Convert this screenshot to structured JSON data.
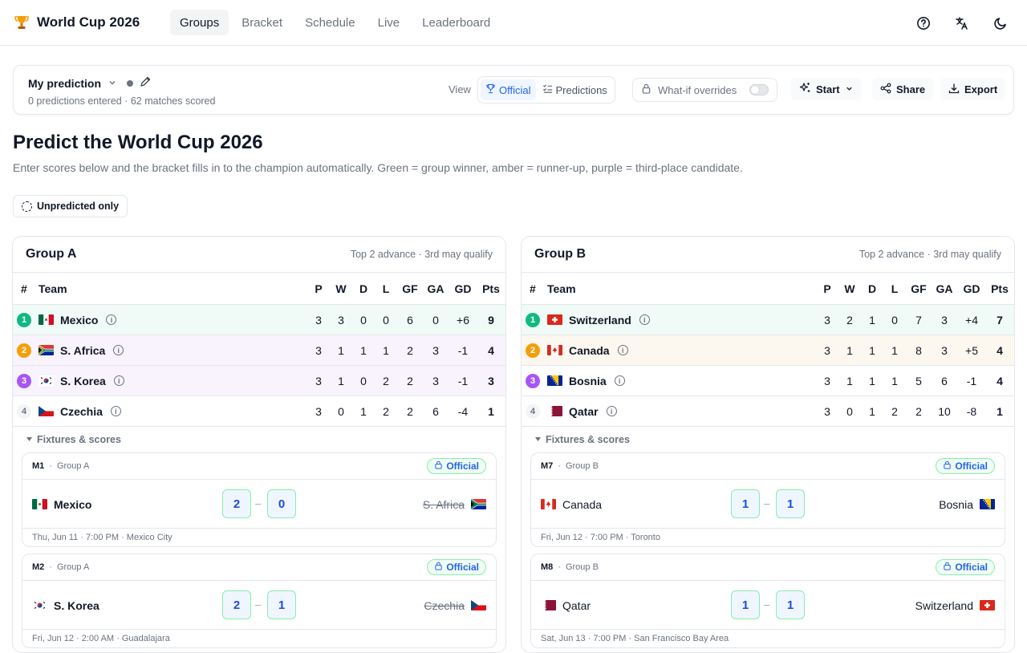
{
  "app": {
    "title": "World Cup 2026"
  },
  "nav": {
    "tabs": [
      {
        "label": "Groups"
      },
      {
        "label": "Bracket"
      },
      {
        "label": "Schedule"
      },
      {
        "label": "Live"
      },
      {
        "label": "Leaderboard"
      }
    ],
    "active": "Groups"
  },
  "prediction": {
    "name": "My prediction",
    "subtitle": "0 predictions entered · 62 matches scored",
    "view_label": "View",
    "view_official": "Official",
    "view_predictions": "Predictions",
    "whatif_label": "What-if overrides",
    "whatif_enabled": false,
    "start_label": "Start",
    "share_label": "Share",
    "export_label": "Export"
  },
  "page": {
    "title": "Predict the World Cup 2026",
    "subtitle": "Enter scores below and the bracket fills in to the champion automatically. Green = group winner, amber = runner-up, purple = third-place candidate.",
    "filter_label": "Unpredicted only"
  },
  "table_headers": {
    "num": "#",
    "team": "Team",
    "p": "P",
    "w": "W",
    "d": "D",
    "l": "L",
    "gf": "GF",
    "ga": "GA",
    "gd": "GD",
    "pts": "Pts"
  },
  "colors": {
    "winner": "#10b981",
    "runner_up": "#f59e0b",
    "third": "#a855f7",
    "accent": "#2563eb"
  },
  "groups": [
    {
      "name": "Group A",
      "note": "Top 2 advance · 3rd may qualify",
      "fixtures_label": "Fixtures & scores",
      "rows": [
        {
          "rank": "1",
          "team": "Mexico",
          "flag": "mexico",
          "p": "3",
          "w": "3",
          "d": "0",
          "l": "0",
          "gf": "6",
          "ga": "0",
          "gd": "+6",
          "pts": "9"
        },
        {
          "rank": "2",
          "team": "S. Africa",
          "flag": "south-africa",
          "p": "3",
          "w": "1",
          "d": "1",
          "l": "1",
          "gf": "2",
          "ga": "3",
          "gd": "-1",
          "pts": "4"
        },
        {
          "rank": "3",
          "team": "S. Korea",
          "flag": "south-korea",
          "p": "3",
          "w": "1",
          "d": "0",
          "l": "2",
          "gf": "2",
          "ga": "3",
          "gd": "-1",
          "pts": "3"
        },
        {
          "rank": "4",
          "team": "Czechia",
          "flag": "czechia",
          "p": "3",
          "w": "0",
          "d": "1",
          "l": "2",
          "gf": "2",
          "ga": "6",
          "gd": "-4",
          "pts": "1"
        }
      ],
      "matches": [
        {
          "id": "M1",
          "group": "Group A",
          "badge": "Official",
          "home": "Mexico",
          "away": "S. Africa",
          "home_score": "2",
          "away_score": "0",
          "info": "Thu, Jun 11 · 7:00 PM · Mexico City"
        },
        {
          "id": "M2",
          "group": "Group A",
          "badge": "Official",
          "home": "S. Korea",
          "away": "Czechia",
          "home_score": "2",
          "away_score": "1",
          "info": "Fri, Jun 12 · 2:00 AM · Guadalajara"
        }
      ]
    },
    {
      "name": "Group B",
      "note": "Top 2 advance · 3rd may qualify",
      "fixtures_label": "Fixtures & scores",
      "rows": [
        {
          "rank": "1",
          "team": "Switzerland",
          "flag": "switzerland",
          "p": "3",
          "w": "2",
          "d": "1",
          "l": "0",
          "gf": "7",
          "ga": "3",
          "gd": "+4",
          "pts": "7"
        },
        {
          "rank": "2",
          "team": "Canada",
          "flag": "canada",
          "p": "3",
          "w": "1",
          "d": "1",
          "l": "1",
          "gf": "8",
          "ga": "3",
          "gd": "+5",
          "pts": "4"
        },
        {
          "rank": "3",
          "team": "Bosnia",
          "flag": "bosnia",
          "p": "3",
          "w": "1",
          "d": "1",
          "l": "1",
          "gf": "5",
          "ga": "6",
          "gd": "-1",
          "pts": "4"
        },
        {
          "rank": "4",
          "team": "Qatar",
          "flag": "qatar",
          "p": "3",
          "w": "0",
          "d": "1",
          "l": "2",
          "gf": "2",
          "ga": "10",
          "gd": "-8",
          "pts": "1"
        }
      ],
      "matches": [
        {
          "id": "M7",
          "group": "Group B",
          "badge": "Official",
          "home": "Canada",
          "away": "Bosnia",
          "home_score": "1",
          "away_score": "1",
          "info": "Fri, Jun 12 · 7:00 PM · Toronto"
        },
        {
          "id": "M8",
          "group": "Group B",
          "badge": "Official",
          "home": "Qatar",
          "away": "Switzerland",
          "home_score": "1",
          "away_score": "1",
          "info": "Sat, Jun 13 · 7:00 PM · San Francisco Bay Area"
        }
      ]
    }
  ]
}
